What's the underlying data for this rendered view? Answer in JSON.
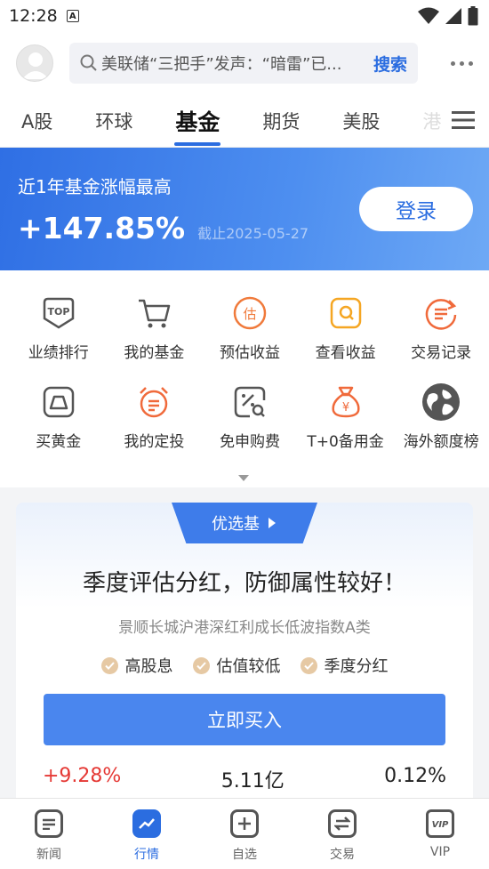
{
  "status_bar": {
    "time": "12:28",
    "notification_letter": "A"
  },
  "search": {
    "placeholder": "美联储“三把手”发声：“暗雷”已...",
    "button": "搜索"
  },
  "tabs": [
    {
      "label": "A股"
    },
    {
      "label": "环球"
    },
    {
      "label": "基金",
      "active": true
    },
    {
      "label": "期货"
    },
    {
      "label": "美股"
    },
    {
      "label": "港"
    }
  ],
  "banner": {
    "title": "近1年基金涨幅最高",
    "value": "+147.85%",
    "date": "截止2025-05-27",
    "login": "登录"
  },
  "grid": [
    [
      {
        "label": "业绩排行",
        "icon": "top-rank-icon"
      },
      {
        "label": "我的基金",
        "icon": "cart-icon"
      },
      {
        "label": "预估收益",
        "icon": "estimate-icon"
      },
      {
        "label": "查看收益",
        "icon": "view-earnings-icon"
      },
      {
        "label": "交易记录",
        "icon": "trade-record-icon"
      }
    ],
    [
      {
        "label": "买黄金",
        "icon": "gold-bar-icon"
      },
      {
        "label": "我的定投",
        "icon": "alarm-clock-icon"
      },
      {
        "label": "免申购费",
        "icon": "discount-icon"
      },
      {
        "label": "T+0备用金",
        "icon": "money-bag-icon"
      },
      {
        "label": "海外额度榜",
        "icon": "globe-icon"
      }
    ]
  ],
  "card": {
    "tag": "优选基",
    "title": "季度评估分红，防御属性较好！",
    "fund_name": "景顺长城沪港深红利成长低波指数A类",
    "features": [
      "高股息",
      "估值较低",
      "季度分红"
    ],
    "buy_button": "立即买入",
    "stats": [
      "+9.28%",
      "5.11亿",
      "0.12%"
    ]
  },
  "tabbar": [
    {
      "label": "新闻",
      "icon": "news-icon"
    },
    {
      "label": "行情",
      "icon": "market-icon",
      "active": true
    },
    {
      "label": "自选",
      "icon": "watchlist-icon"
    },
    {
      "label": "交易",
      "icon": "trade-icon"
    },
    {
      "label": "VIP",
      "icon": "vip-icon"
    }
  ],
  "colors": {
    "accent": "#2b6de0",
    "red": "#e53935",
    "orange": "#f07a3b"
  }
}
